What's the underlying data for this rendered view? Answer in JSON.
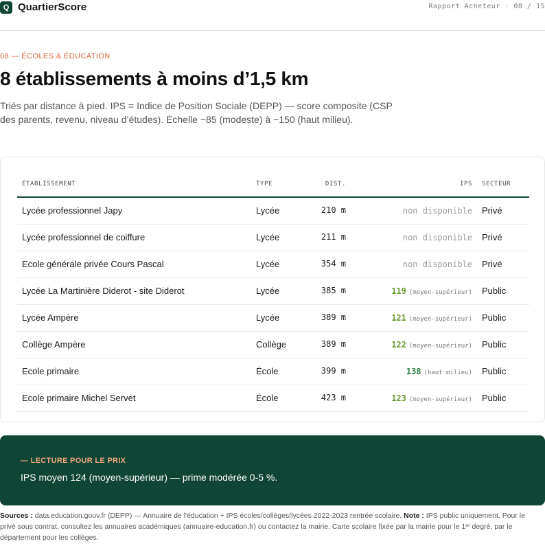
{
  "header": {
    "logo_letter": "Q",
    "brand": "QuartierScore",
    "report_meta": "Rapport Acheteur · 08 / 15"
  },
  "section": {
    "eyebrow": "08 — ÉCOLES & ÉDUCATION",
    "title": "8 établissements à moins d’1,5 km",
    "intro": "Triés par distance à pied. IPS = Indice de Position Sociale (DEPP) — score composite (CSP des parents, revenu, niveau d’études). Échelle ~85 (modeste) à ~150 (haut milieu)."
  },
  "table": {
    "columns": {
      "name": "ÉTABLISSEMENT",
      "type": "TYPE",
      "dist": "DIST.",
      "ips": "IPS",
      "sector": "SECTEUR"
    },
    "rows": [
      {
        "name": "Lycée professionnel Japy",
        "type": "Lycée",
        "dist": "210 m",
        "ips_value": "",
        "ips_category": "",
        "ips_na": "non disponible",
        "ips_color": "",
        "sector": "Privé"
      },
      {
        "name": "Lycée professionnel de coiffure",
        "type": "Lycée",
        "dist": "211 m",
        "ips_value": "",
        "ips_category": "",
        "ips_na": "non disponible",
        "ips_color": "",
        "sector": "Privé"
      },
      {
        "name": "Ecole générale privée Cours Pascal",
        "type": "Lycée",
        "dist": "354 m",
        "ips_value": "",
        "ips_category": "",
        "ips_na": "non disponible",
        "ips_color": "",
        "sector": "Privé"
      },
      {
        "name": "Lycée La Martinière Diderot - site Diderot",
        "type": "Lycée",
        "dist": "385 m",
        "ips_value": "119",
        "ips_category": "(moyen-supérieur)",
        "ips_na": "",
        "ips_color": "#6a9a2e",
        "sector": "Public"
      },
      {
        "name": "Lycée Ampère",
        "type": "Lycée",
        "dist": "389 m",
        "ips_value": "121",
        "ips_category": "(moyen-supérieur)",
        "ips_na": "",
        "ips_color": "#6a9a2e",
        "sector": "Public"
      },
      {
        "name": "Collège Ampère",
        "type": "Collège",
        "dist": "389 m",
        "ips_value": "122",
        "ips_category": "(moyen-supérieur)",
        "ips_na": "",
        "ips_color": "#6a9a2e",
        "sector": "Public"
      },
      {
        "name": "Ecole primaire",
        "type": "École",
        "dist": "399 m",
        "ips_value": "138",
        "ips_category": "(haut milieu)",
        "ips_na": "",
        "ips_color": "#2f7d46",
        "sector": "Public"
      },
      {
        "name": "Ecole primaire Michel Servet",
        "type": "École",
        "dist": "423 m",
        "ips_value": "123",
        "ips_category": "(moyen-supérieur)",
        "ips_na": "",
        "ips_color": "#6a9a2e",
        "sector": "Public"
      }
    ]
  },
  "lecture": {
    "label": "— LECTURE POUR LE PRIX",
    "text": "IPS moyen 124 (moyen-supérieur) — prime modérée 0-5 %."
  },
  "sources": {
    "label": "Sources :",
    "text": "data.education.gouv.fr (DEPP) — Annuaire de l'éducation + IPS écoles/collèges/lycées 2022-2023 rentrée scolaire.",
    "note_label": "Note :",
    "note_text": "IPS public uniquement. Pour le privé sous contrat, consultez les annuaires académiques (annuaire-education.fr) ou contactez la mairie. Carte scolaire fixée par la mairie pour le 1ᵉʳ degré, par le département pour les collèges."
  }
}
